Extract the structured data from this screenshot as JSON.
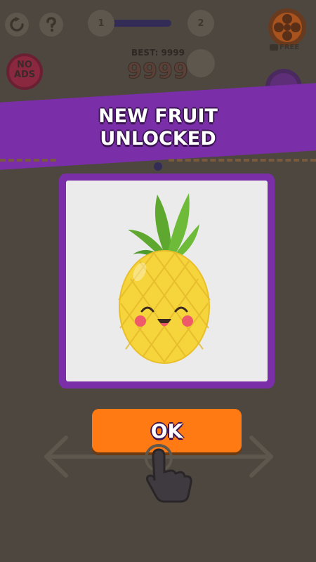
{
  "topbar": {
    "restart_icon": "restart-icon",
    "help_icon": "question-icon",
    "level_current": "1",
    "level_next": "2",
    "free_label": "FREE",
    "gift_icon": "flower-badge-icon"
  },
  "scoreboard": {
    "best_label": "BEST: 9999",
    "score": "9999"
  },
  "no_ads": {
    "line1": "NO",
    "line2": "ADS"
  },
  "popup": {
    "title_line1": "NEW FRUIT",
    "title_line2": "UNLOCKED",
    "fruit_icon": "pineapple-icon",
    "ok_label": "OK"
  },
  "tutorial": {
    "arrows_icon": "left-right-arrows-icon",
    "hand_icon": "pointing-hand-icon"
  },
  "colors": {
    "background": "#4d473f",
    "banner": "#7a2fa8",
    "ok_button": "#ff7a12",
    "panel_bg": "#ebebeb"
  }
}
